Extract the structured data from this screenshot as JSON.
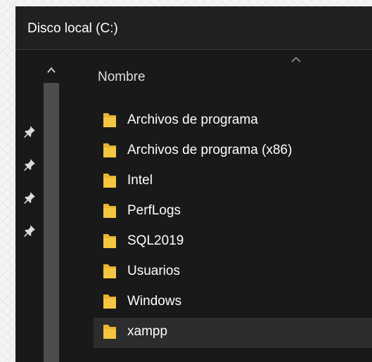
{
  "window": {
    "title": "Disco local (C:)"
  },
  "nav_pane": {
    "pins": [
      "pin-icon",
      "pin-icon",
      "pin-icon",
      "pin-icon"
    ]
  },
  "columns": {
    "name_header": "Nombre",
    "sort_indicator": "sort-ascending-icon"
  },
  "files": [
    {
      "name": "Archivos de programa",
      "icon": "folder-icon",
      "selected": false
    },
    {
      "name": "Archivos de programa (x86)",
      "icon": "folder-icon",
      "selected": false
    },
    {
      "name": "Intel",
      "icon": "folder-icon",
      "selected": false
    },
    {
      "name": "PerfLogs",
      "icon": "folder-icon",
      "selected": false
    },
    {
      "name": "SQL2019",
      "icon": "folder-icon",
      "selected": false
    },
    {
      "name": "Usuarios",
      "icon": "folder-icon",
      "selected": false
    },
    {
      "name": "Windows",
      "icon": "folder-icon",
      "selected": false
    },
    {
      "name": "xampp",
      "icon": "folder-icon",
      "selected": true
    }
  ],
  "colors": {
    "folder": "#e9b430",
    "background": "#191919",
    "title_bar": "#202020",
    "selection": "#2d2d2d",
    "scroll_thumb": "#4d4d4d"
  }
}
